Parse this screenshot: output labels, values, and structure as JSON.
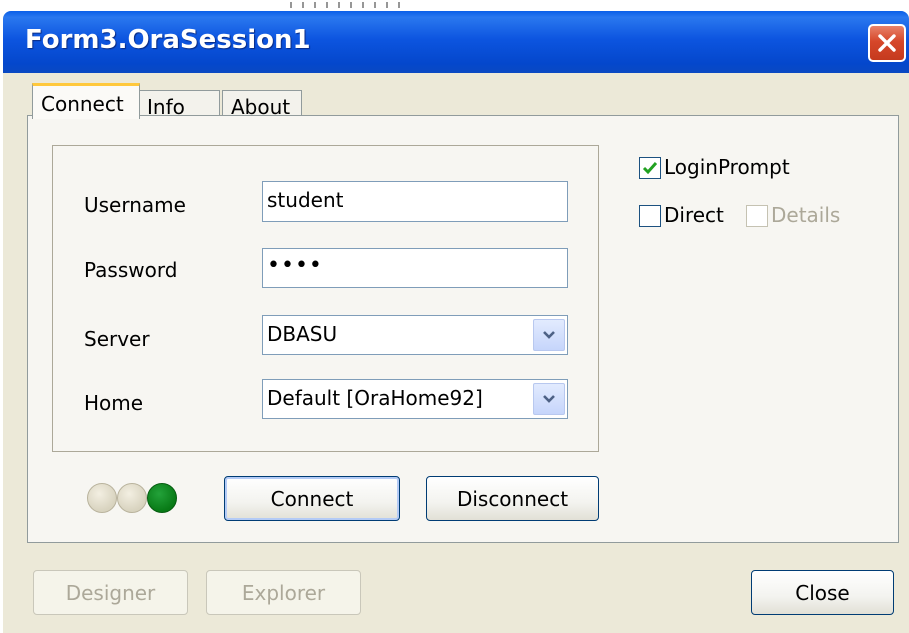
{
  "window": {
    "title": "Form3.OraSession1"
  },
  "tabs": [
    {
      "label": "Connect",
      "active": true
    },
    {
      "label": "Info",
      "active": false
    },
    {
      "label": "About",
      "active": false
    }
  ],
  "connect": {
    "username_label": "Username",
    "username_value": "student",
    "password_label": "Password",
    "password_value": "••••",
    "server_label": "Server",
    "server_value": "DBASU",
    "home_label": "Home",
    "home_value": "Default [OraHome92]"
  },
  "options": {
    "login_prompt": {
      "label": "LoginPrompt",
      "checked": true
    },
    "direct": {
      "label": "Direct",
      "checked": false
    },
    "details": {
      "label": "Details",
      "checked": false,
      "enabled": false
    }
  },
  "status_leds": [
    {
      "name": "led-1",
      "state": "off",
      "color": "#d8d3bf"
    },
    {
      "name": "led-2",
      "state": "off",
      "color": "#d8d3bf"
    },
    {
      "name": "led-3",
      "state": "on",
      "color": "#087a16"
    }
  ],
  "buttons": {
    "connect": "Connect",
    "disconnect": "Disconnect",
    "designer": "Designer",
    "explorer": "Explorer",
    "close": "Close"
  },
  "icons": {
    "title_close": "close-x-icon",
    "dropdown": "chevron-down-icon",
    "check": "checkmark-icon"
  },
  "colors": {
    "titlebar": "#0a55e0",
    "window_bg": "#ece9d8",
    "close_button": "#d6472a",
    "active_tab_highlight": "#ffc83c"
  }
}
